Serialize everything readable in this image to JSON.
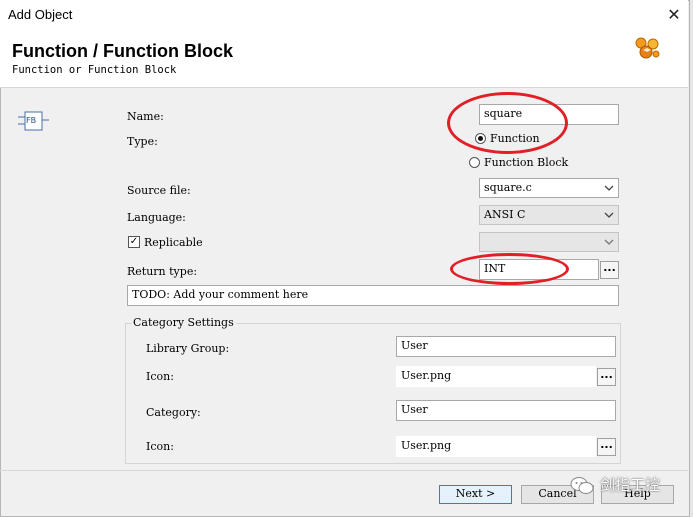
{
  "window": {
    "title": "Add Object",
    "close_glyph": "✕"
  },
  "header": {
    "title": "Function / Function Block",
    "subtitle": "Function or Function Block",
    "logo_icon": "object-wizard-icon"
  },
  "form": {
    "type_icon_text": "FB",
    "name_label": "Name:",
    "name_value": "square",
    "type_label": "Type:",
    "type_options": [
      "Function",
      "Function Block"
    ],
    "type_selected": "Function",
    "source_file_label": "Source file:",
    "source_file_value": "square.c",
    "language_label": "Language:",
    "language_value": "ANSI C",
    "replicable_label": "Replicable",
    "replicable_checked": true,
    "replicable_combo_value": "",
    "return_type_label": "Return type:",
    "return_type_value": "INT",
    "browse_label": "...",
    "comment_value": "TODO: Add your comment here"
  },
  "category": {
    "group_title": "Category Settings",
    "library_group_label": "Library Group:",
    "library_group_value": "User",
    "icon1_label": "Icon:",
    "icon1_value": "User.png",
    "category_label": "Category:",
    "category_value": "User",
    "icon2_label": "Icon:",
    "icon2_value": "User.png"
  },
  "buttons": {
    "next": "Next >",
    "cancel": "Cancel",
    "help": "Help"
  },
  "watermark": "剑指工控",
  "colors": {
    "highlight_oval": "#e01f27",
    "default_button_border": "#3c7fb1"
  }
}
